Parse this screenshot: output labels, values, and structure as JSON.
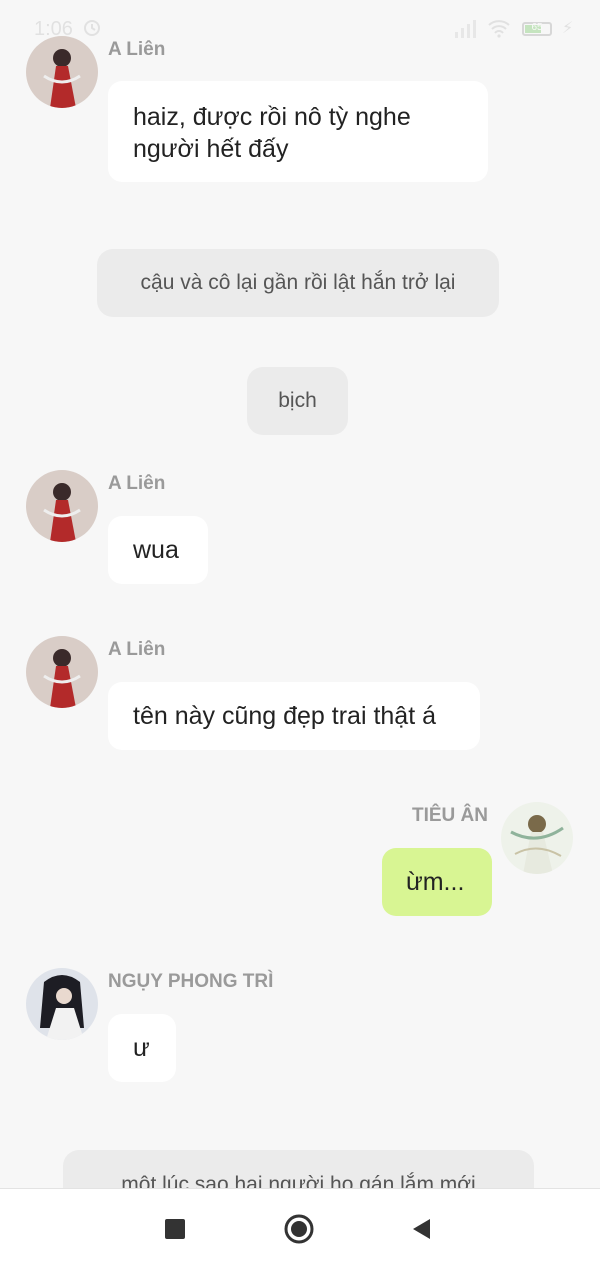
{
  "status_bar": {
    "time": "1:06",
    "battery_percent": 65,
    "battery_label": "65"
  },
  "messages": [
    {
      "sender": "A Liên",
      "text_lines": [
        "haiz, được rồi nô tỳ nghe",
        "người hết đấy"
      ]
    },
    {
      "narration": "cậu và cô lại gần rồi lật hắn trở lại"
    },
    {
      "narration": "bịch"
    },
    {
      "sender": "A Liên",
      "text": "wua"
    },
    {
      "sender": "A Liên",
      "text": "tên này cũng đẹp trai thật á"
    },
    {
      "sender": "TIÊU ÂN",
      "text": "ừm...",
      "mine": true
    },
    {
      "sender": "NGỤY PHONG TRÌ",
      "text": "ư"
    },
    {
      "narration": "một lúc sao hai người họ gán lắm mới"
    }
  ],
  "nav": {
    "icons": [
      "square-icon",
      "circle-home-icon",
      "back-triangle-icon"
    ]
  },
  "colors": {
    "background": "#f7f7f7",
    "bubble": "#ffffff",
    "my_bubble": "#d8f593",
    "narration": "#ebebeb"
  }
}
